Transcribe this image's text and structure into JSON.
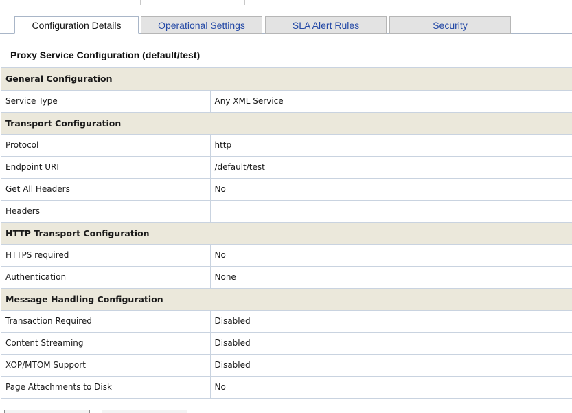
{
  "tabs": [
    {
      "label": "Configuration Details",
      "active": true
    },
    {
      "label": "Operational Settings",
      "active": false
    },
    {
      "label": "SLA Alert Rules",
      "active": false
    },
    {
      "label": "Security",
      "active": false
    }
  ],
  "panel": {
    "title": "Proxy Service Configuration (default/test)"
  },
  "sections": [
    {
      "heading": "General Configuration",
      "rows": [
        {
          "label": "Service Type",
          "value": "Any XML Service"
        }
      ]
    },
    {
      "heading": "Transport Configuration",
      "rows": [
        {
          "label": "Protocol",
          "value": "http"
        },
        {
          "label": "Endpoint URI",
          "value": "/default/test"
        },
        {
          "label": "Get All Headers",
          "value": "No"
        },
        {
          "label": "Headers",
          "value": ""
        }
      ]
    },
    {
      "heading": "HTTP Transport Configuration",
      "rows": [
        {
          "label": "HTTPS required",
          "value": "No"
        },
        {
          "label": "Authentication",
          "value": "None"
        }
      ]
    },
    {
      "heading": "Message Handling Configuration",
      "rows": [
        {
          "label": "Transaction Required",
          "value": "Disabled"
        },
        {
          "label": "Content Streaming",
          "value": "Disabled"
        },
        {
          "label": "XOP/MTOM Support",
          "value": "Disabled"
        },
        {
          "label": "Page Attachments to Disk",
          "value": "No"
        }
      ]
    }
  ],
  "colors": {
    "section_bg": "#ebe8db",
    "tab_link": "#2449a6",
    "border": "#c9d3e0"
  }
}
